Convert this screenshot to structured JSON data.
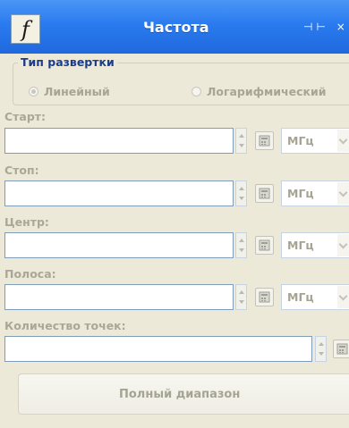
{
  "window": {
    "title": "Частота",
    "app_icon_letter": "f",
    "title_buttons": "⊣⊢ ×"
  },
  "sweep_type": {
    "legend": "Тип развертки",
    "options": [
      {
        "label": "Линейный",
        "selected": true
      },
      {
        "label": "Логарифмический",
        "selected": false
      }
    ]
  },
  "fields": {
    "start": {
      "label": "Старт:",
      "value": "",
      "unit": "МГц"
    },
    "stop": {
      "label": "Стоп:",
      "value": "",
      "unit": "МГц"
    },
    "center": {
      "label": "Центр:",
      "value": "",
      "unit": "МГц"
    },
    "span": {
      "label": "Полоса:",
      "value": "",
      "unit": "МГц"
    },
    "points": {
      "label": "Количество точек:",
      "value": ""
    }
  },
  "full_range_button": "Полный диапазон",
  "colors": {
    "titlebar": "#2a7bef",
    "background": "#ece9d8",
    "legend_text": "#1b3c8c",
    "disabled_text": "#a5a494",
    "input_border": "#7f9db9"
  }
}
